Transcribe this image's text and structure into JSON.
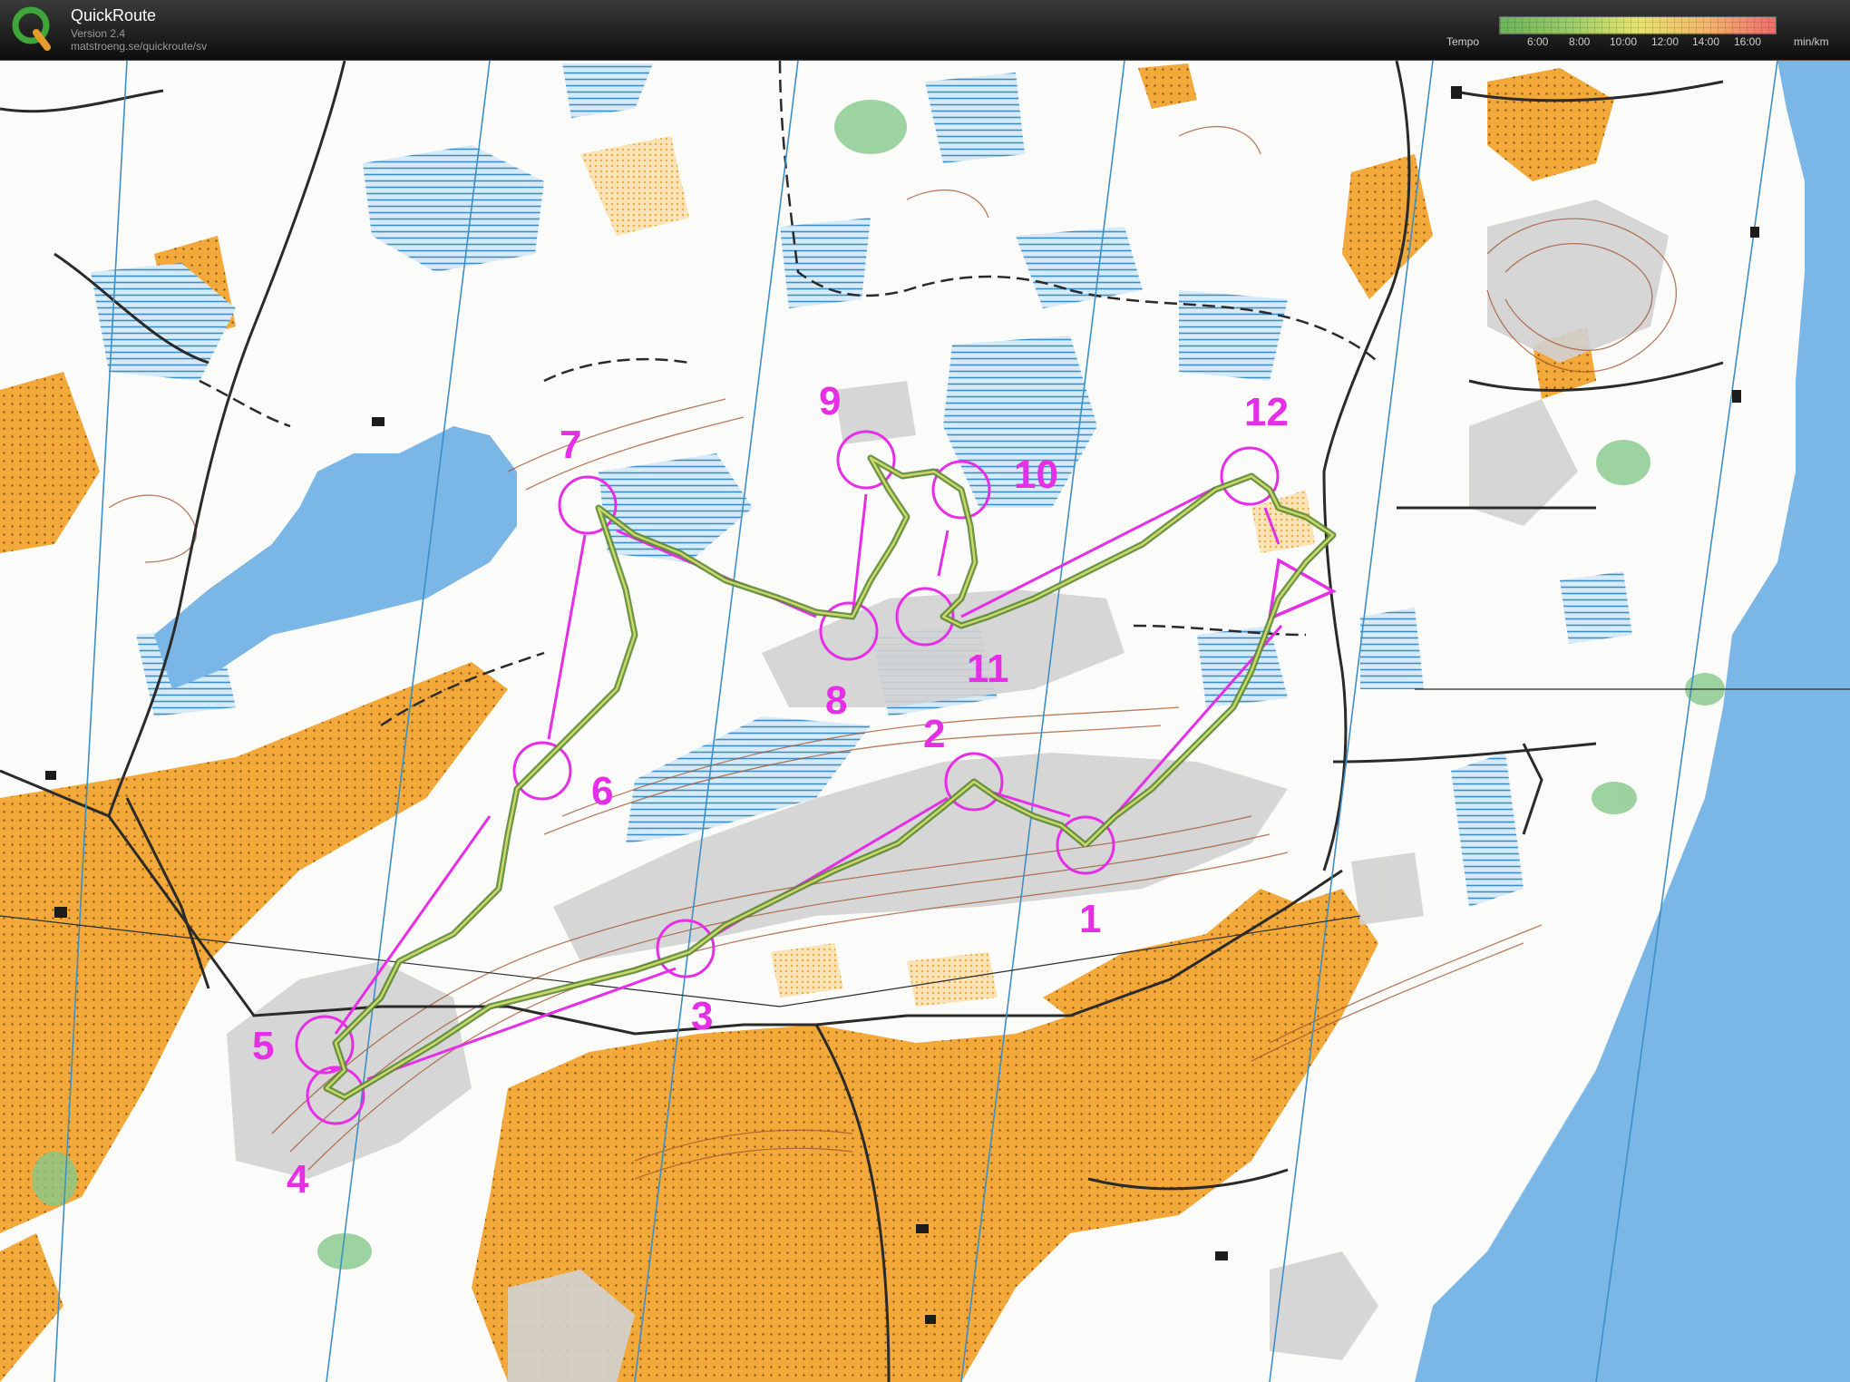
{
  "app": {
    "name": "QuickRoute",
    "version": "Version 2.4",
    "url": "matstroeng.se/quickroute/sv"
  },
  "tempo_legend": {
    "label": "Tempo",
    "ticks": [
      "6:00",
      "8:00",
      "10:00",
      "12:00",
      "14:00",
      "16:00"
    ],
    "unit": "min/km",
    "colors": [
      "#6db45a",
      "#9acb6a",
      "#e5e56d",
      "#f4b56b",
      "#ef6d6d"
    ]
  },
  "map": {
    "colors": {
      "forest": "#ffffff",
      "open_land": "#f3a93a",
      "rough_open": "#f8cf8a",
      "water": "#7ab6e6",
      "marsh": "#3d8fc7",
      "rock": "#cfcfcf",
      "contour": "#a0522d",
      "course": "#e62ee6",
      "route": "#6f9a3e"
    },
    "controls": [
      {
        "label": "1"
      },
      {
        "label": "2"
      },
      {
        "label": "3"
      },
      {
        "label": "4"
      },
      {
        "label": "5"
      },
      {
        "label": "6"
      },
      {
        "label": "7"
      },
      {
        "label": "8"
      },
      {
        "label": "9"
      },
      {
        "label": "10"
      },
      {
        "label": "11"
      },
      {
        "label": "12"
      }
    ],
    "start_symbol": "start-triangle"
  }
}
